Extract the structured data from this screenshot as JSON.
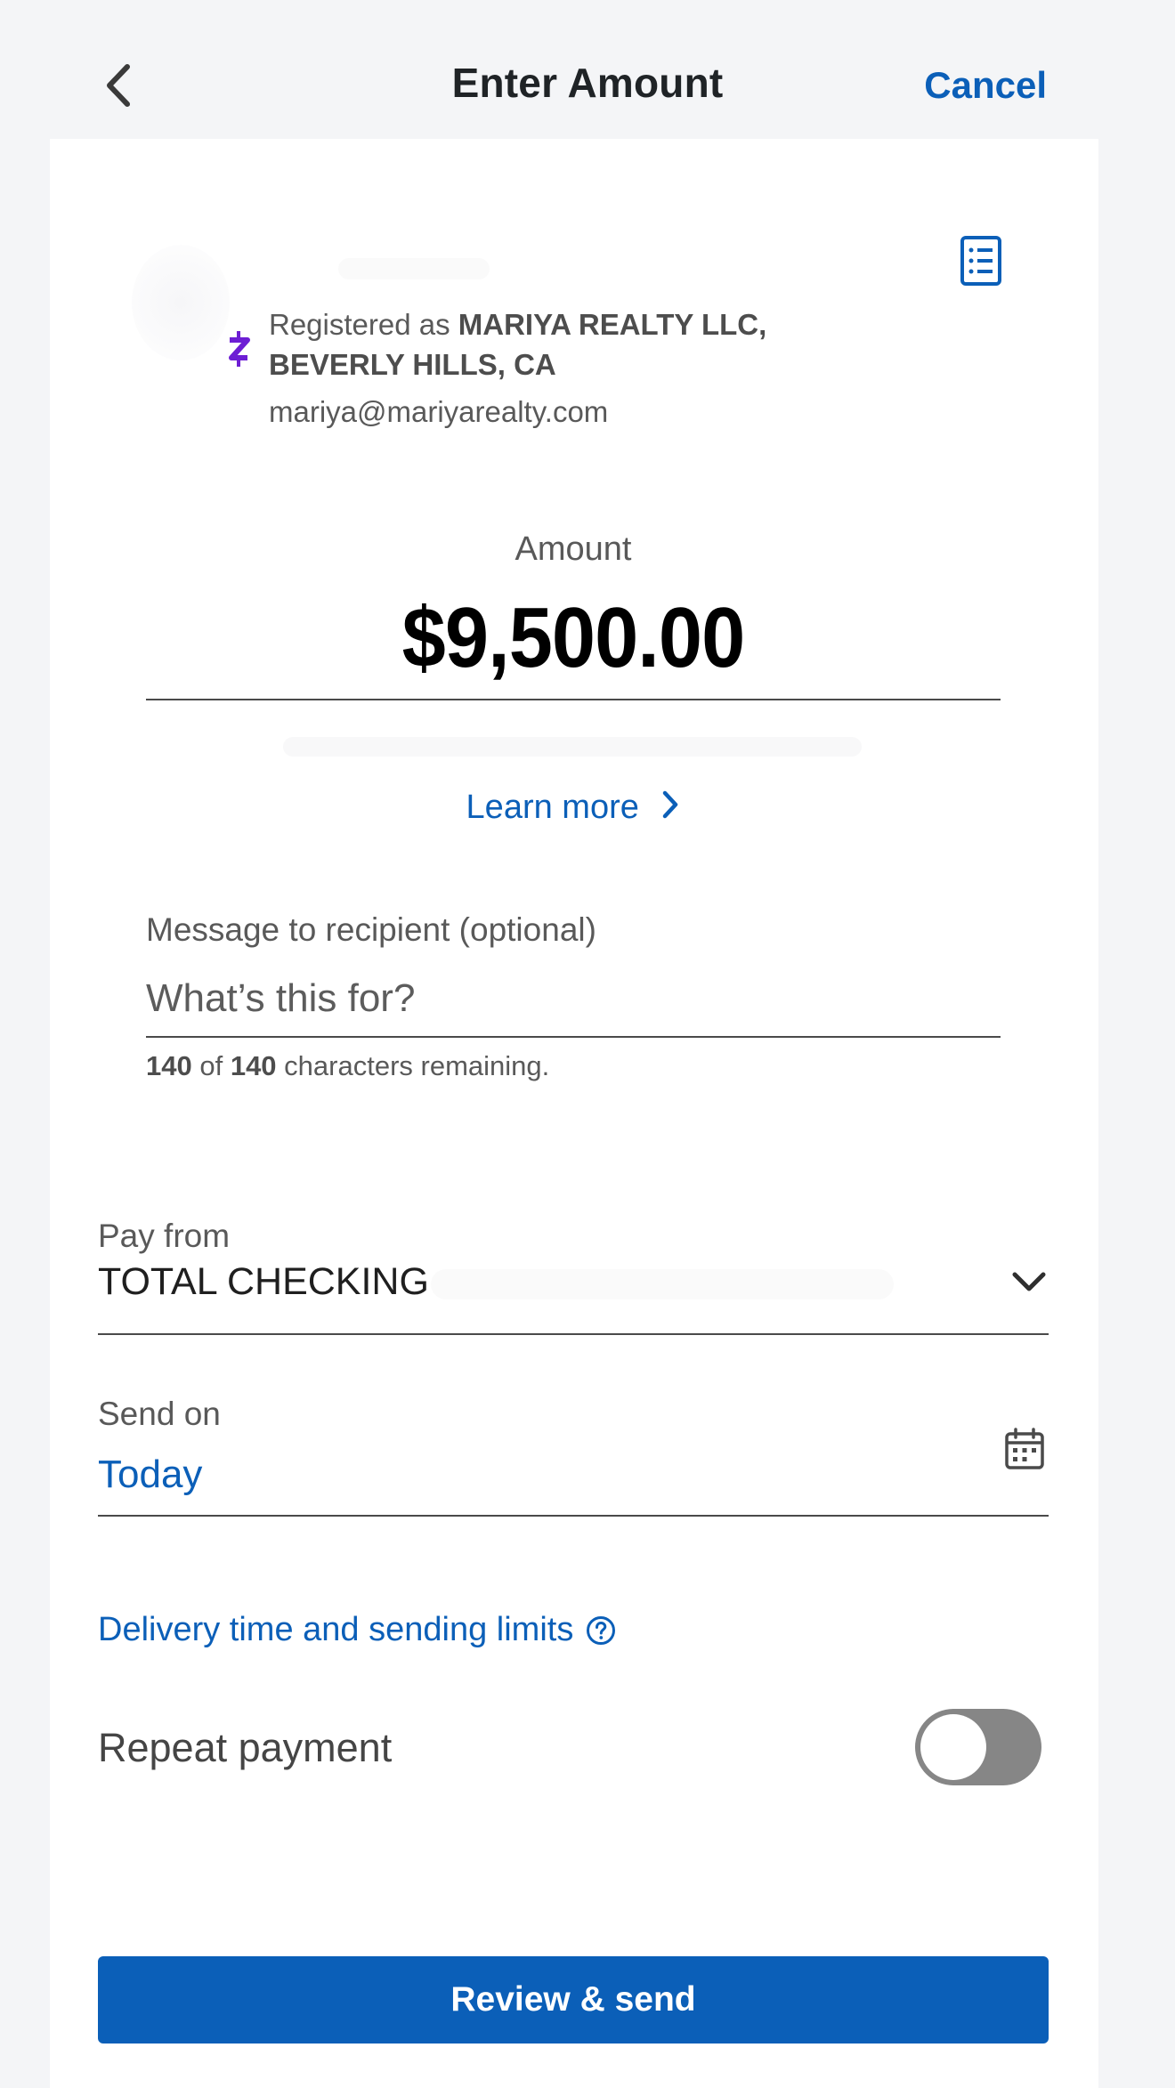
{
  "header": {
    "title": "Enter Amount",
    "cancel_label": "Cancel"
  },
  "recipient": {
    "registered_prefix": "Registered as ",
    "registered_name": "MARIYA REALTY LLC, BEVERLY HILLS, CA",
    "email": "mariya@mariyarealty.com",
    "network_icon": "zelle-z-icon"
  },
  "amount": {
    "label": "Amount",
    "value": "$9,500.00"
  },
  "learn_more": {
    "label": "Learn more"
  },
  "message": {
    "label": "Message to recipient (optional)",
    "placeholder": "What’s this for?",
    "value": "",
    "remaining_count": "140",
    "remaining_of": " of ",
    "remaining_max": "140",
    "remaining_suffix": " characters remaining."
  },
  "pay_from": {
    "label": "Pay from",
    "value": "TOTAL CHECKING"
  },
  "send_on": {
    "label": "Send on",
    "value": "Today"
  },
  "delivery": {
    "label": "Delivery time and sending limits"
  },
  "repeat": {
    "label": "Repeat payment",
    "enabled": false
  },
  "review_button": {
    "label": "Review & send"
  },
  "colors": {
    "accent": "#0b5fb8",
    "zelle_purple": "#6d1ed4",
    "toggle_off": "#868686",
    "background": "#f4f5f7"
  }
}
